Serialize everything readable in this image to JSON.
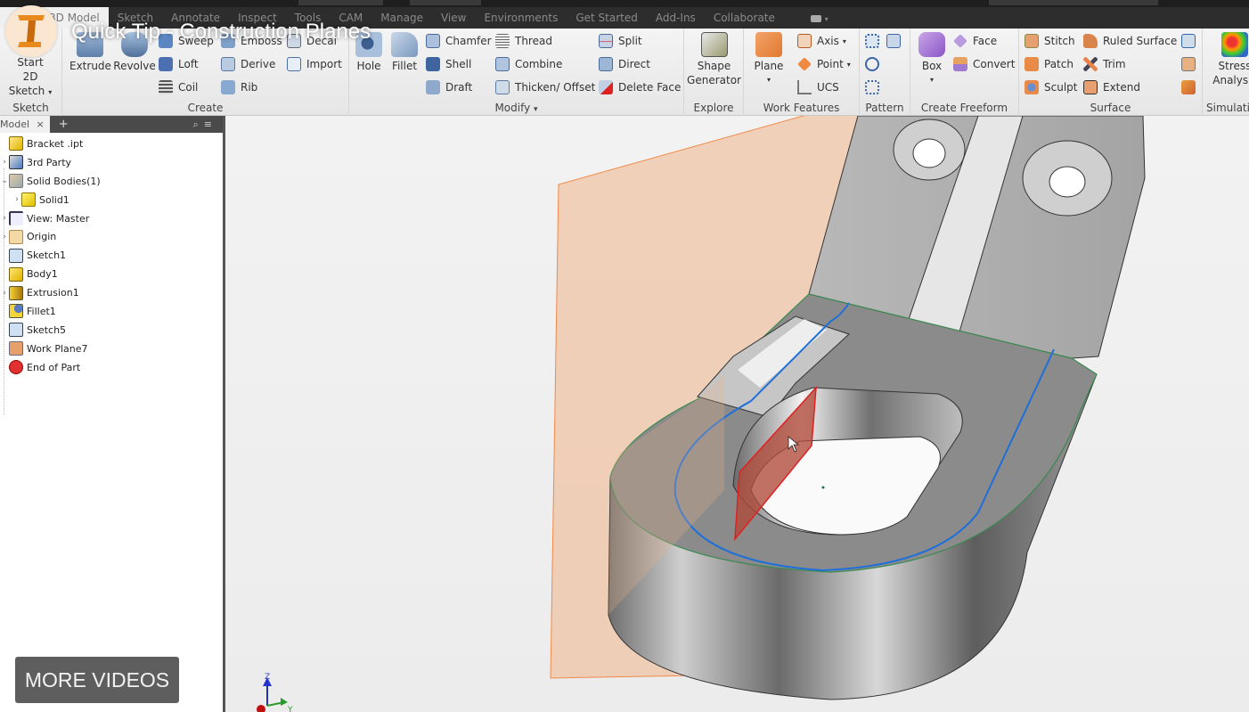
{
  "video": {
    "title": "Quick Tip - Construction Planes",
    "more_videos_label": "MORE VIDEOS"
  },
  "ribbon_tabs": [
    {
      "label": "3D Model",
      "active": true
    },
    {
      "label": "Sketch"
    },
    {
      "label": "Annotate"
    },
    {
      "label": "Inspect"
    },
    {
      "label": "Tools"
    },
    {
      "label": "CAM"
    },
    {
      "label": "Manage"
    },
    {
      "label": "View"
    },
    {
      "label": "Environments"
    },
    {
      "label": "Get Started"
    },
    {
      "label": "Add-Ins"
    },
    {
      "label": "Collaborate"
    }
  ],
  "ribbon": {
    "sketch": {
      "label": "Sketch",
      "start": "Start",
      "start2": "2D Sketch"
    },
    "create": {
      "label": "Create",
      "extrude": "Extrude",
      "revolve": "Revolve",
      "sweep": "Sweep",
      "loft": "Loft",
      "coil": "Coil",
      "emboss": "Emboss",
      "derive": "Derive",
      "rib": "Rib",
      "decal": "Decal",
      "import": "Import"
    },
    "modify": {
      "label": "Modify",
      "hole": "Hole",
      "fillet": "Fillet",
      "chamfer": "Chamfer",
      "shell": "Shell",
      "draft": "Draft",
      "thread": "Thread",
      "combine": "Combine",
      "thicken": "Thicken/ Offset",
      "split": "Split",
      "direct": "Direct",
      "delete_face": "Delete Face"
    },
    "explore": {
      "label": "Explore",
      "shape": "Shape",
      "generator": "Generator"
    },
    "work_features": {
      "label": "Work Features",
      "plane": "Plane",
      "axis": "Axis",
      "point": "Point",
      "ucs": "UCS"
    },
    "pattern": {
      "label": "Pattern"
    },
    "freeform": {
      "label": "Create Freeform",
      "box": "Box",
      "face": "Face",
      "convert": "Convert"
    },
    "surface": {
      "label": "Surface",
      "stitch": "Stitch",
      "patch": "Patch",
      "sculpt": "Sculpt",
      "ruled": "Ruled Surface",
      "trim": "Trim",
      "extend": "Extend"
    },
    "simulation": {
      "label": "Simulation",
      "stress": "Stress",
      "analysis": "Analysis"
    }
  },
  "browser": {
    "tab_label": "Model",
    "close": "×",
    "add": "+",
    "nodes": [
      {
        "label": "Bracket .ipt",
        "toggle": "",
        "icon": "part"
      },
      {
        "label": "3rd Party",
        "toggle": "›",
        "icon": "third-party"
      },
      {
        "label": "Solid Bodies(1)",
        "toggle": "⌄",
        "icon": "solid-bodies"
      },
      {
        "label": "Solid1",
        "toggle": "›",
        "icon": "solid"
      },
      {
        "label": "View: Master",
        "toggle": "›",
        "icon": "view"
      },
      {
        "label": "Origin",
        "toggle": "›",
        "icon": "folder"
      },
      {
        "label": "Sketch1",
        "toggle": "",
        "icon": "sketch"
      },
      {
        "label": "Body1",
        "toggle": "",
        "icon": "body"
      },
      {
        "label": "Extrusion1",
        "toggle": "›",
        "icon": "extrusion"
      },
      {
        "label": "Fillet1",
        "toggle": "",
        "icon": "fillet"
      },
      {
        "label": "Sketch5",
        "toggle": "",
        "icon": "sketch"
      },
      {
        "label": "Work Plane7",
        "toggle": "",
        "icon": "work-plane"
      },
      {
        "label": "End of Part",
        "toggle": "",
        "icon": "end-of-part"
      }
    ]
  },
  "triad": {
    "z": "Z",
    "y": "Y"
  },
  "colors": {
    "work_plane": "#f0b48a",
    "selected_plane": "#d42020",
    "sketch_line": "#1e6fd9",
    "edge_green": "#3a8a50"
  }
}
